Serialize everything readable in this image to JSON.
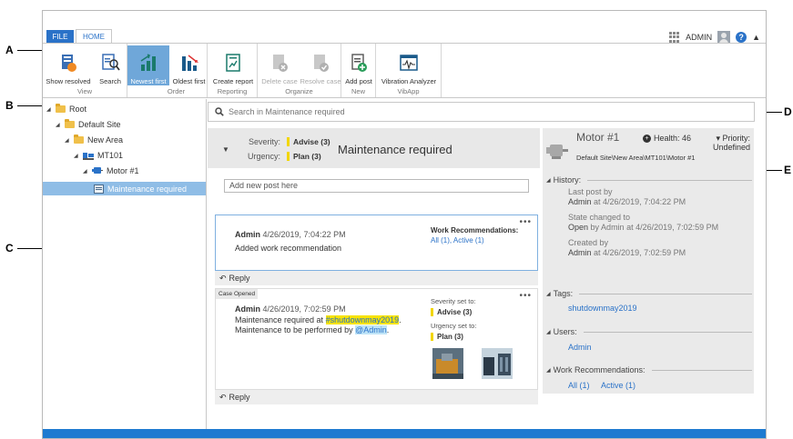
{
  "callouts": [
    "A",
    "B",
    "C",
    "D",
    "E"
  ],
  "tabs": {
    "file": "FILE",
    "home": "HOME"
  },
  "user": {
    "name": "ADMIN",
    "help": "?"
  },
  "ribbon": {
    "groups": [
      {
        "label": "View",
        "buttons": [
          "Show resolved",
          "Search"
        ]
      },
      {
        "label": "Order",
        "buttons": [
          "Newest first",
          "Oldest first"
        ]
      },
      {
        "label": "Reporting",
        "buttons": [
          "Create report"
        ]
      },
      {
        "label": "Organize",
        "buttons": [
          "Delete case",
          "Resolve case"
        ]
      },
      {
        "label": "New",
        "buttons": [
          "Add post"
        ]
      },
      {
        "label": "VibApp",
        "buttons": [
          "Vibration Analyzer"
        ]
      }
    ],
    "active_button": "Newest first",
    "disabled_buttons": [
      "Delete case",
      "Resolve case"
    ]
  },
  "tree": {
    "items": [
      "Root",
      "Default Site",
      "New Area",
      "MT101",
      "Motor #1",
      "Maintenance required"
    ],
    "selected": "Maintenance required"
  },
  "search": {
    "placeholder": "Search in Maintenance required"
  },
  "case": {
    "severity_label": "Severity:",
    "severity_value": "Advise (3)",
    "urgency_label": "Urgency:",
    "urgency_value": "Plan (3)",
    "title": "Maintenance required"
  },
  "feed": {
    "new_post_placeholder": "Add new post here",
    "reply_label": "Reply",
    "post1": {
      "author": "Admin",
      "timestamp": "4/26/2019, 7:04:22 PM",
      "text": "Added work recommendation",
      "wr_title": "Work Recommendations:",
      "wr_all": "All (1),",
      "wr_active": "Active (1)"
    },
    "post2": {
      "badge": "Case Opened",
      "author": "Admin",
      "timestamp": "4/26/2019, 7:02:59 PM",
      "line1_prefix": "Maintenance required at ",
      "hashtag": "#shutdownmay2019",
      "line1_suffix": ".",
      "line2_prefix": "Maintenance to be performed by ",
      "mention": "@Admin",
      "line2_suffix": ".",
      "severity_set": "Severity set to:",
      "severity_value": "Advise (3)",
      "urgency_set": "Urgency set to:",
      "urgency_value": "Plan (3)"
    }
  },
  "asset": {
    "title": "Motor #1",
    "health": "Health: 46",
    "priority_label": "Priority:",
    "priority_value": "Undefined",
    "path": "Default Site\\New Area\\MT101\\Motor #1",
    "history_title": "History:",
    "last_post_label": "Last post by",
    "last_post_by": "Admin",
    "last_post_at": "at 4/26/2019, 7:04:22 PM",
    "state_label": "State changed to",
    "state_value": "Open",
    "state_by": "by Admin at 4/26/2019, 7:02:59 PM",
    "created_label": "Created by",
    "created_by": "Admin",
    "created_at": "at 4/26/2019, 7:02:59 PM",
    "tags_title": "Tags:",
    "tag": "shutdownmay2019",
    "users_title": "Users:",
    "user": "Admin",
    "wr_title": "Work Recommendations:",
    "wr_all": "All (1)",
    "wr_active": "Active (1)"
  }
}
